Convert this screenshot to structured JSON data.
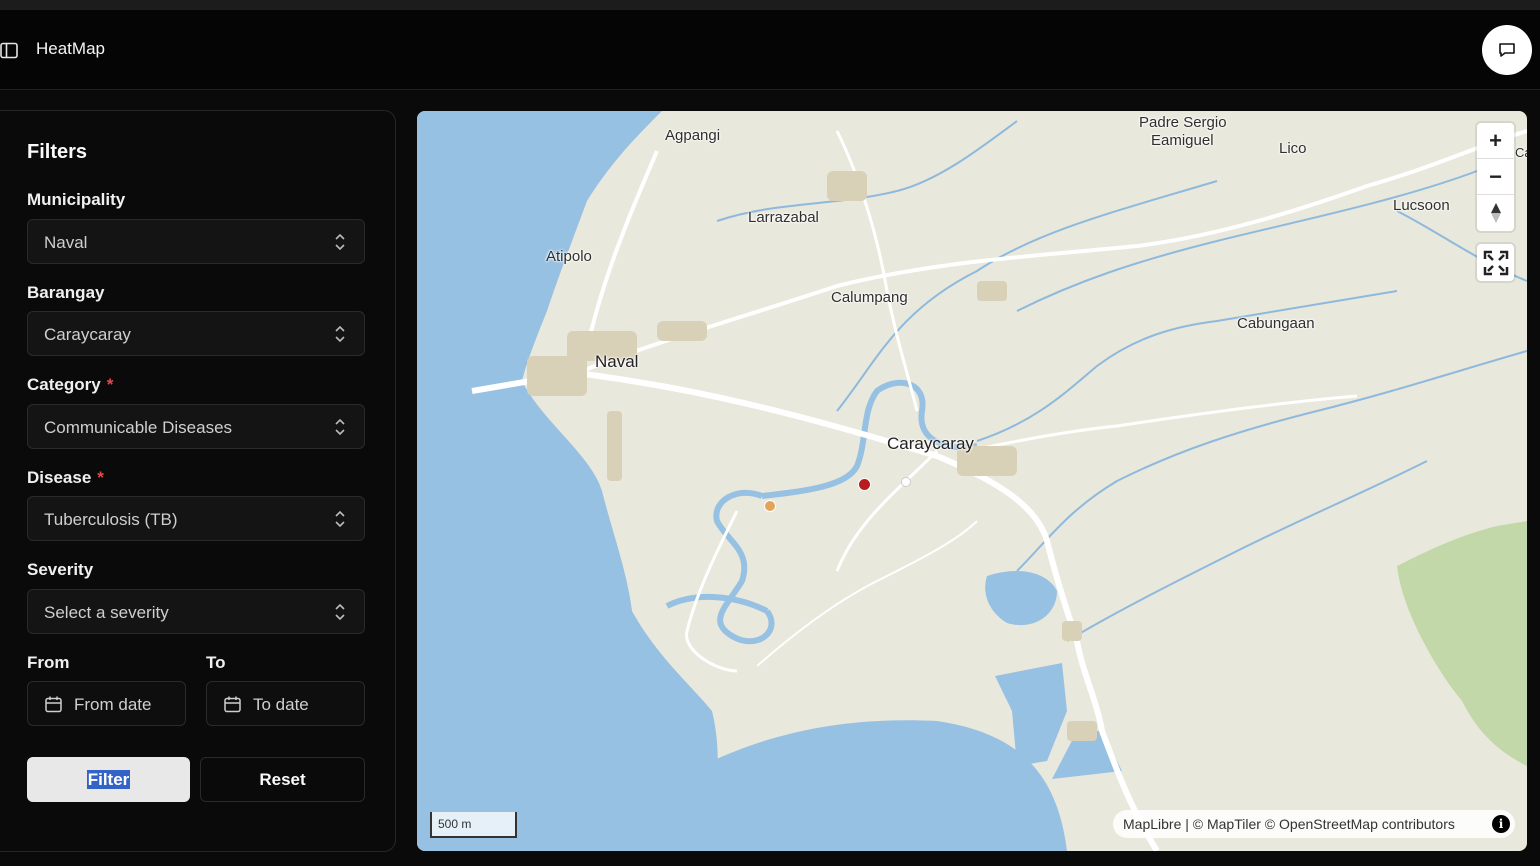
{
  "header": {
    "title": "HeatMap"
  },
  "filters": {
    "title": "Filters",
    "municipality": {
      "label": "Municipality",
      "value": "Naval"
    },
    "barangay": {
      "label": "Barangay",
      "value": "Caraycaray"
    },
    "category": {
      "label": "Category",
      "required_mark": "*",
      "value": "Communicable Diseases"
    },
    "disease": {
      "label": "Disease",
      "required_mark": "*",
      "value": "Tuberculosis (TB)"
    },
    "severity": {
      "label": "Severity",
      "placeholder": "Select a severity"
    },
    "from": {
      "label": "From",
      "placeholder": "From date"
    },
    "to": {
      "label": "To",
      "placeholder": "To date"
    },
    "filter_label": "Filter",
    "reset_label": "Reset"
  },
  "map": {
    "places": {
      "agpangi": "Agpangi",
      "padre_sergio": "Padre Sergio",
      "eamiguel": "Eamiguel",
      "lico": "Lico",
      "ca": "Ca",
      "lucsoon": "Lucsoon",
      "larrazabal": "Larrazabal",
      "atipolo": "Atipolo",
      "calumpang": "Calumpang",
      "cabungaan": "Cabungaan",
      "naval": "Naval",
      "caraycaray": "Caraycaray"
    },
    "zoom_in": "+",
    "zoom_out": "−",
    "scale_label": "500 m",
    "attribution": "MapLibre | © MapTiler © OpenStreetMap contributors",
    "info": "i",
    "markers": [
      {
        "severity": "high",
        "color": "#b91c1c"
      },
      {
        "severity": "medium",
        "color": "#e3a35a"
      },
      {
        "severity": "low",
        "color": "#ffffff"
      }
    ],
    "colors": {
      "water": "#97c1e3",
      "land": "#e9e8dc",
      "park": "#c2d8a8",
      "road": "#ffffff"
    }
  }
}
